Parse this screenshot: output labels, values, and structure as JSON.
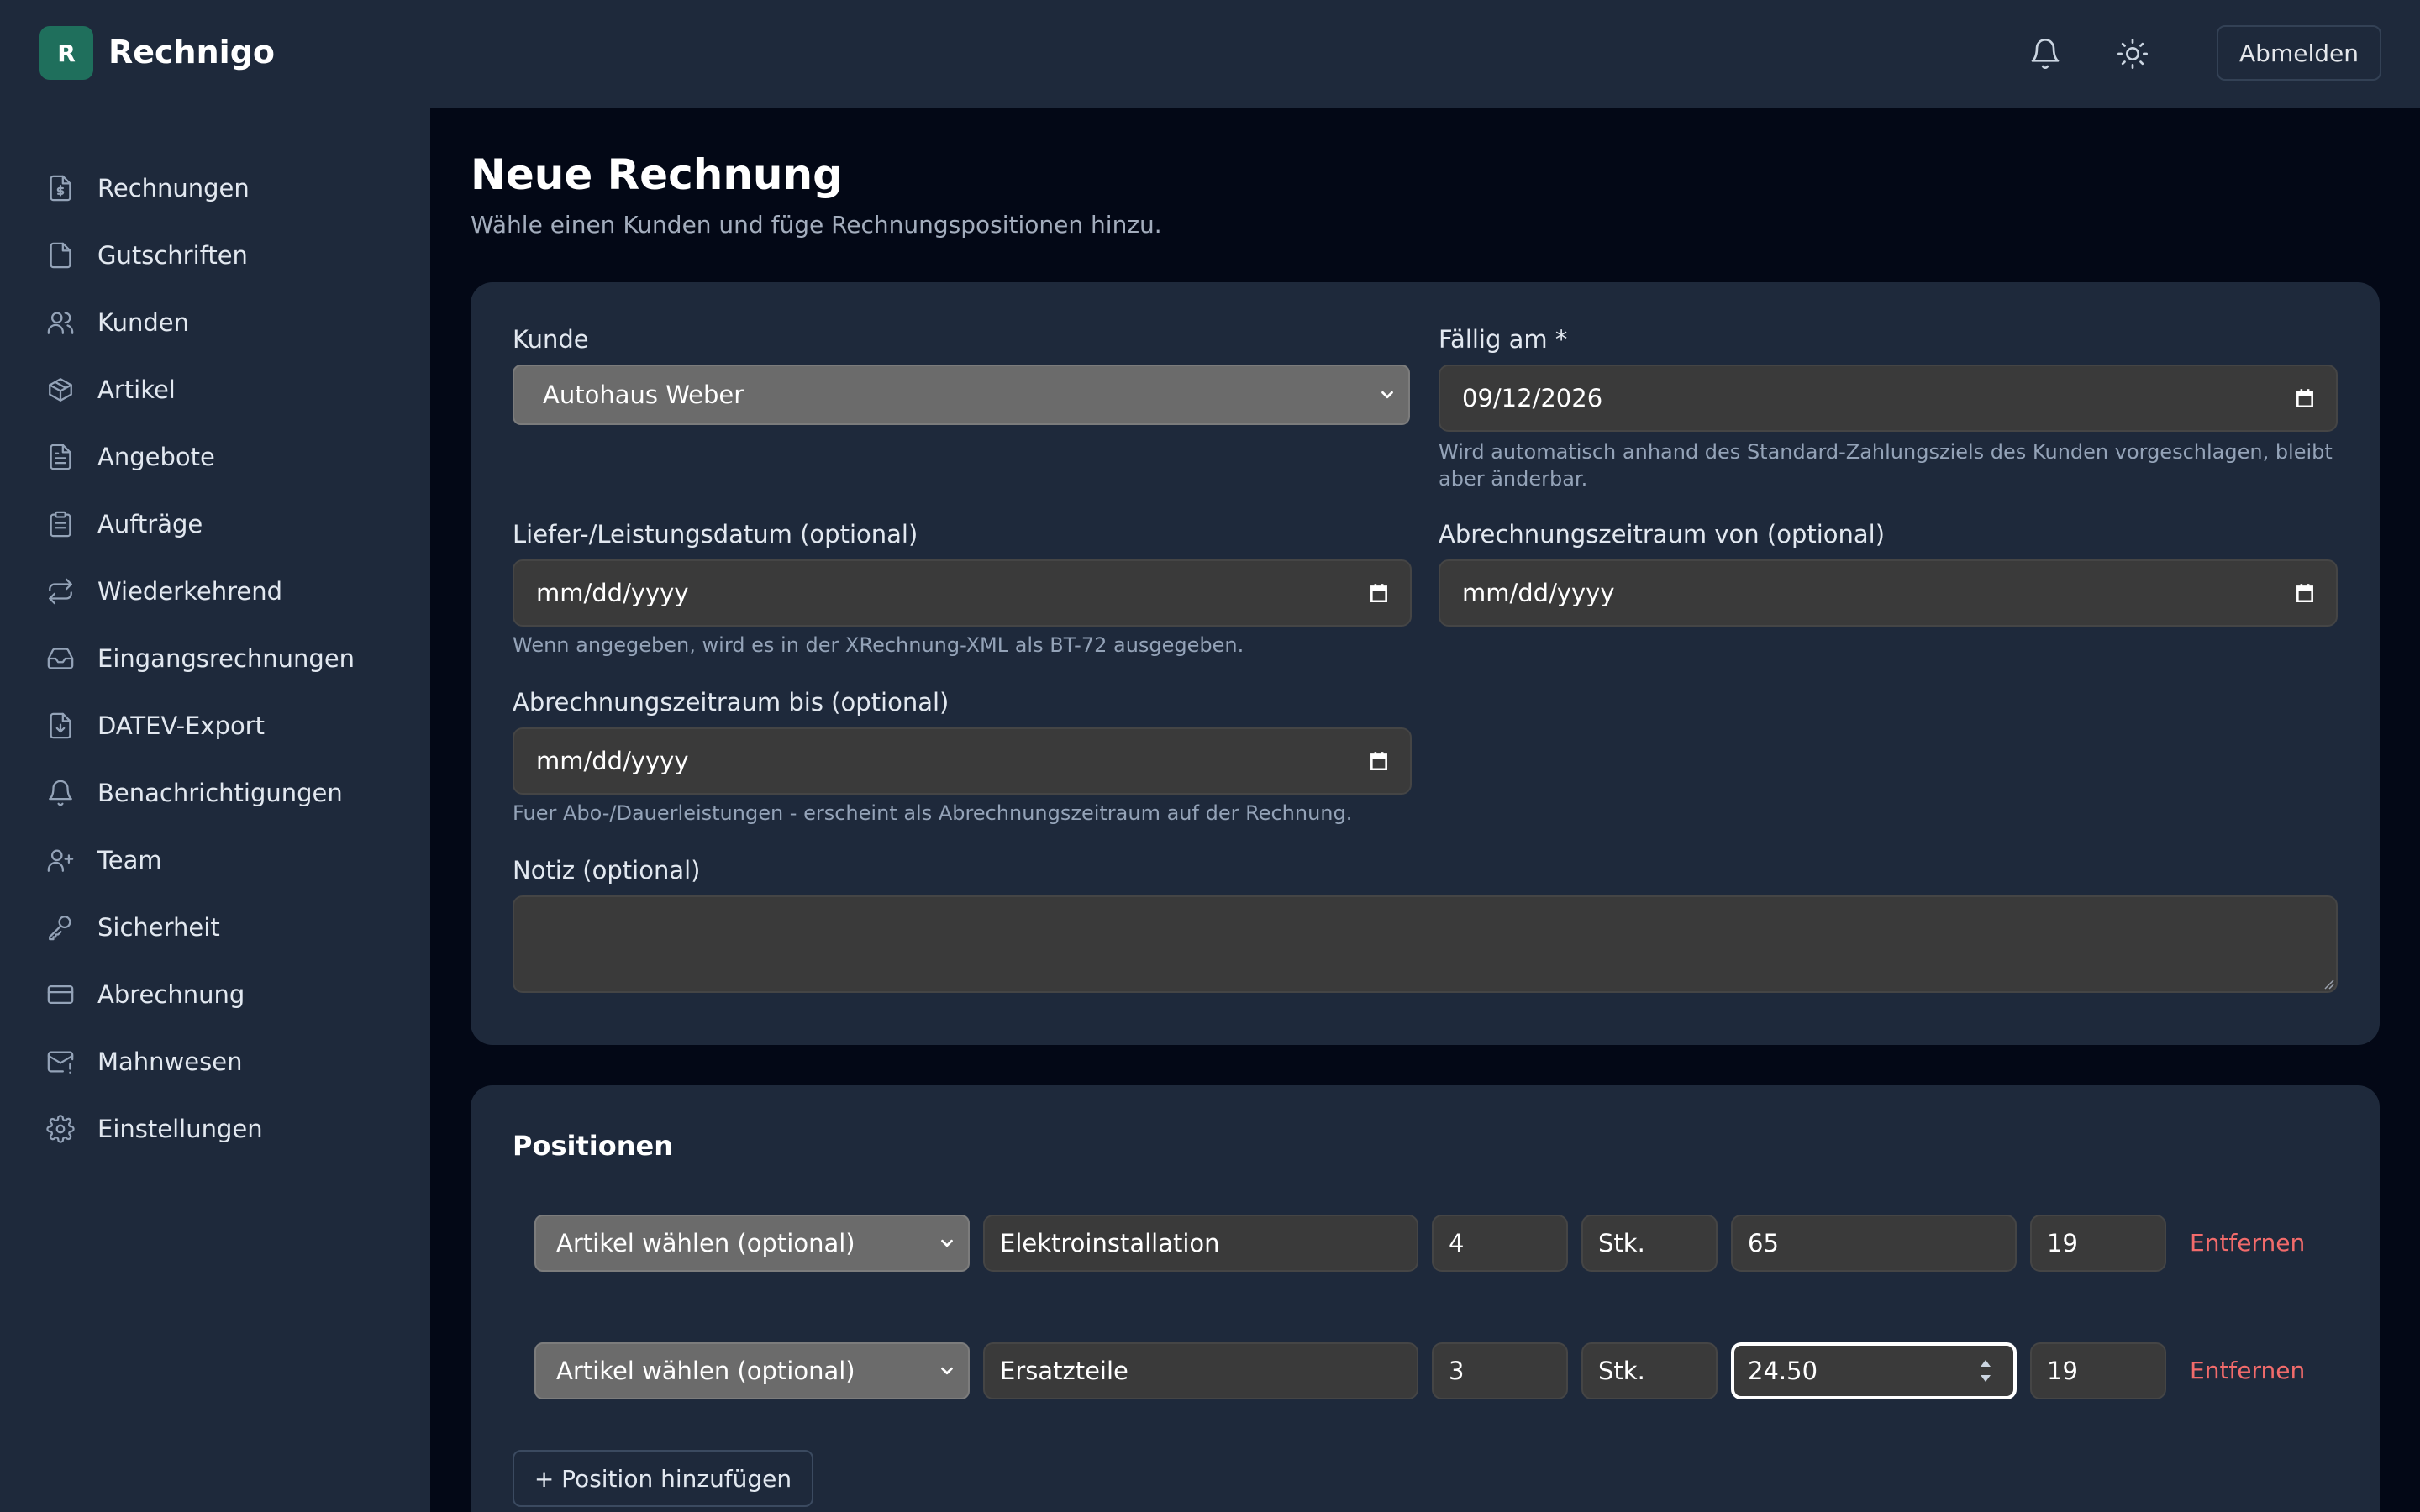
{
  "header": {
    "logo_letter": "R",
    "app_name": "Rechnigo",
    "notifications_icon": "bell-icon",
    "theme_icon": "sun-icon",
    "logout_label": "Abmelden"
  },
  "sidebar": {
    "items": [
      {
        "label": "Rechnungen",
        "icon": "invoice-dollar-icon"
      },
      {
        "label": "Gutschriften",
        "icon": "document-icon"
      },
      {
        "label": "Kunden",
        "icon": "users-icon"
      },
      {
        "label": "Artikel",
        "icon": "package-icon"
      },
      {
        "label": "Angebote",
        "icon": "document-text-icon"
      },
      {
        "label": "Aufträge",
        "icon": "clipboard-icon"
      },
      {
        "label": "Wiederkehrend",
        "icon": "repeat-icon"
      },
      {
        "label": "Eingangsrechnungen",
        "icon": "inbox-icon"
      },
      {
        "label": "DATEV-Export",
        "icon": "file-download-icon"
      },
      {
        "label": "Benachrichtigungen",
        "icon": "bell-icon"
      },
      {
        "label": "Team",
        "icon": "user-plus-icon"
      },
      {
        "label": "Sicherheit",
        "icon": "key-icon"
      },
      {
        "label": "Abrechnung",
        "icon": "credit-card-icon"
      },
      {
        "label": "Mahnwesen",
        "icon": "mail-alert-icon"
      },
      {
        "label": "Einstellungen",
        "icon": "gear-icon"
      }
    ]
  },
  "page": {
    "title": "Neue Rechnung",
    "subtitle": "Wähle einen Kunden und füge Rechnungspositionen hinzu."
  },
  "form": {
    "customer_label": "Kunde",
    "customer_value": "Autohaus Weber",
    "due_label": "Fällig am *",
    "due_value": "09/12/2026",
    "due_hint": "Wird automatisch anhand des Standard-Zahlungsziels des Kunden vorgeschlagen, bleibt aber änderbar.",
    "delivery_label": "Liefer-/Leistungsdatum (optional)",
    "delivery_value": "mm/dd/yyyy",
    "delivery_hint": "Wenn angegeben, wird es in der XRechnung-XML als BT-72 ausgegeben.",
    "period_from_label": "Abrechnungszeitraum von (optional)",
    "period_from_value": "mm/dd/yyyy",
    "period_to_label": "Abrechnungszeitraum bis (optional)",
    "period_to_value": "mm/dd/yyyy",
    "period_to_hint": "Fuer Abo-/Dauerleistungen - erscheint als Abrechnungszeitraum auf der Rechnung.",
    "note_label": "Notiz (optional)",
    "note_value": ""
  },
  "positions": {
    "title": "Positionen",
    "rows": [
      {
        "article": "Artikel wählen (optional)",
        "description": "Elektroinstallation",
        "quantity": "4",
        "unit": "Stk.",
        "price": "65",
        "tax": "19",
        "remove": "Entfernen"
      },
      {
        "article": "Artikel wählen (optional)",
        "description": "Ersatzteile",
        "quantity": "3",
        "unit": "Stk.",
        "price": "24.50",
        "tax": "19",
        "remove": "Entfernen"
      }
    ],
    "add_label": "+ Position hinzufügen"
  },
  "colors": {
    "accent": "#1f6f5c",
    "danger": "#f26b6b",
    "surface": "#1e293b",
    "background": "#030816"
  }
}
